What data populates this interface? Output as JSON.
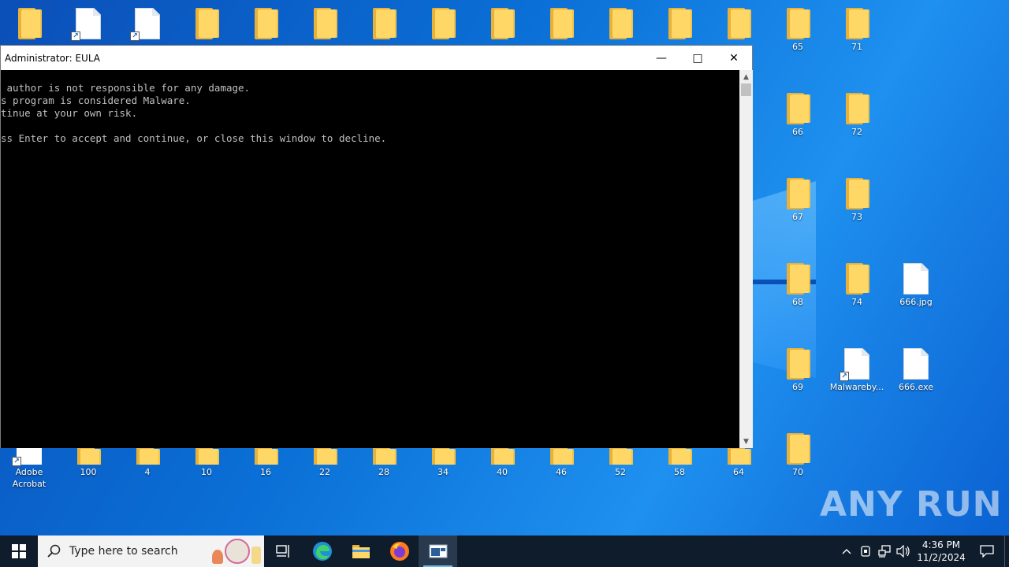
{
  "desktop": {
    "top_row": [
      {
        "type": "folder",
        "label": ""
      },
      {
        "type": "doc-shortcut",
        "label": ""
      },
      {
        "type": "doc-shortcut",
        "label": ""
      },
      {
        "type": "folder",
        "label": ""
      },
      {
        "type": "folder",
        "label": ""
      },
      {
        "type": "folder",
        "label": ""
      },
      {
        "type": "folder",
        "label": ""
      },
      {
        "type": "folder",
        "label": ""
      },
      {
        "type": "folder",
        "label": ""
      },
      {
        "type": "folder",
        "label": ""
      },
      {
        "type": "folder",
        "label": ""
      },
      {
        "type": "folder",
        "label": ""
      },
      {
        "type": "folder",
        "label": ""
      }
    ],
    "right_col1": [
      "65",
      "66",
      "67",
      "68",
      "69",
      "70"
    ],
    "right_col2": [
      "71",
      "72",
      "73",
      "74",
      "Malwareby..."
    ],
    "right_col3": [
      "666.jpg",
      "666.exe"
    ],
    "bottom_row": [
      "Adobe Acrobat",
      "100",
      "4",
      "10",
      "16",
      "22",
      "28",
      "34",
      "40",
      "46",
      "52",
      "58",
      "64"
    ]
  },
  "window": {
    "title": "Administrator:  EULA",
    "minimize_glyph": "—",
    "maximize_glyph": "□",
    "close_glyph": "✕",
    "console_lines": [
      " author is not responsible for any damage.",
      "s program is considered Malware.",
      "tinue at your own risk.",
      "",
      "ss Enter to accept and continue, or close this window to decline."
    ]
  },
  "taskbar": {
    "search_placeholder": "Type here to search",
    "time": "4:36 PM",
    "date": "11/2/2024",
    "tray_chevron": "^"
  },
  "watermark": {
    "text": "ANY RUN"
  }
}
